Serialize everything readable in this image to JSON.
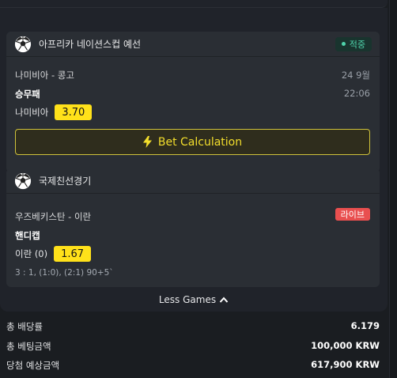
{
  "cards": [
    {
      "league": "아프리카 네이션스컵 예선",
      "status_badge": "적중",
      "match": "나미비아 - 콩고",
      "date": "24 9월",
      "time": "22:06",
      "market": "승무패",
      "pick": "나미비아",
      "odds": "3.70",
      "icon": "soccer-ball-icon"
    },
    {
      "league": "국제친선경기",
      "status_badge": "라이브",
      "match": "우즈베키스탄 - 이란",
      "market": "핸디캡",
      "pick": "이란 (0)",
      "odds": "1.67",
      "score": "3 : 1, (1:0), (2:1) 90+5`",
      "icon": "soccer-ball-icon"
    }
  ],
  "bet_button": {
    "label": "Bet Calculation",
    "icon": "lightning-icon"
  },
  "less_games": {
    "label": "Less Games",
    "icon": "chevron-up-icon"
  },
  "summary": [
    {
      "label": "총 배당률",
      "value": "6.179"
    },
    {
      "label": "총 베팅금액",
      "value": "100,000 KRW"
    },
    {
      "label": "당첨 예상금액",
      "value": "617,900 KRW"
    }
  ],
  "colors": {
    "odds": "#ffe11a",
    "accent_gold": "#f3de2c",
    "won_green": "#4fd3ab",
    "live_red": "#e94f4f"
  }
}
